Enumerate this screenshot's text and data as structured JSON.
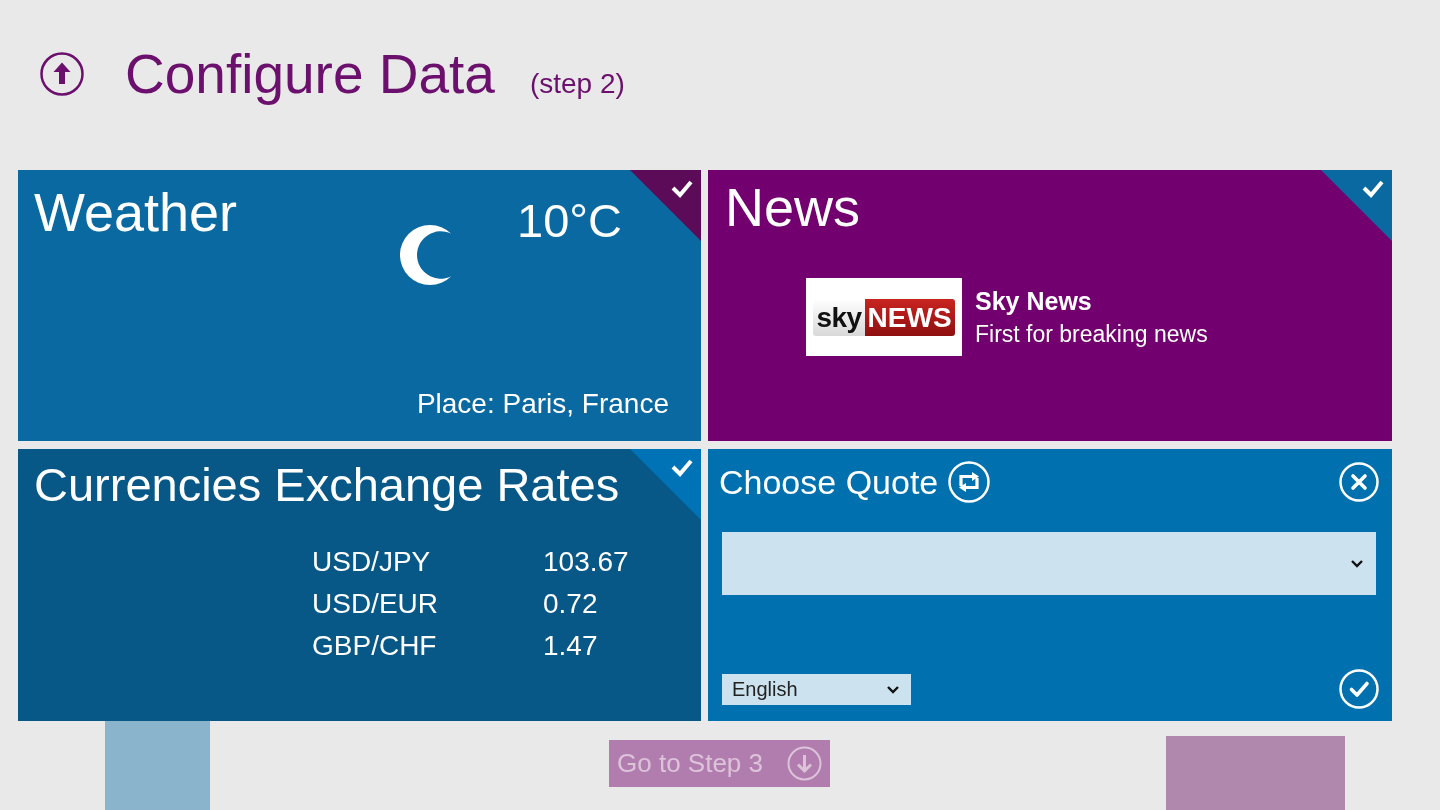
{
  "header": {
    "title": "Configure Data",
    "step": "(step 2)"
  },
  "tiles": [
    {
      "kind": "weather",
      "title": "Weather",
      "selected": true,
      "temperature": "10°C",
      "place": "Place: Paris, France"
    },
    {
      "kind": "news",
      "title": "News",
      "selected": true,
      "source": {
        "logo_word": "sky",
        "logo_badge": "NEWS",
        "name": "Sky News",
        "tagline": "First for breaking news"
      }
    },
    {
      "kind": "currencies",
      "title": "Currencies Exchange Rates",
      "selected": true,
      "rates": [
        {
          "pair": "USD/JPY",
          "value": "103.67"
        },
        {
          "pair": "USD/EUR",
          "value": "0.72"
        },
        {
          "pair": "GBP/CHF",
          "value": "1.47"
        }
      ]
    },
    {
      "kind": "quote",
      "title": "Choose Quote",
      "selected": false,
      "language": "English"
    }
  ],
  "next_button": {
    "label": "Go to Step 3",
    "disabled": true
  }
}
